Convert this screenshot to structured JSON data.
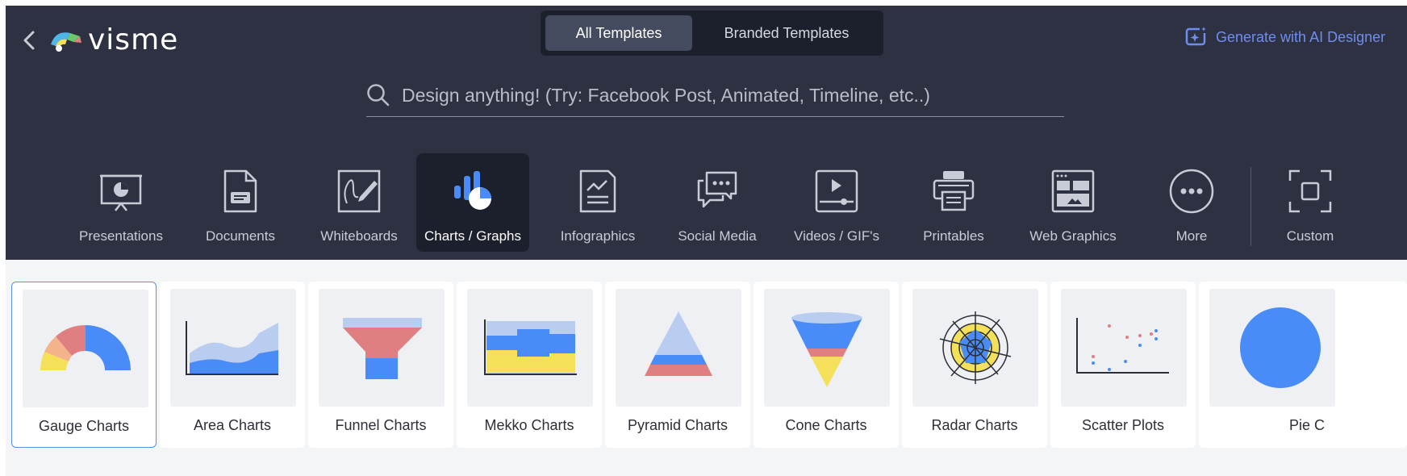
{
  "brand": {
    "name": "visme"
  },
  "tabs": [
    {
      "label": "All Templates"
    },
    {
      "label": "Branded Templates"
    }
  ],
  "ai_button": {
    "label": "Generate with AI Designer"
  },
  "search": {
    "placeholder": "Design anything! (Try: Facebook Post, Animated, Timeline, etc..)"
  },
  "categories": [
    {
      "label": "Presentations",
      "icon": "presentation-icon"
    },
    {
      "label": "Documents",
      "icon": "document-icon"
    },
    {
      "label": "Whiteboards",
      "icon": "whiteboard-icon"
    },
    {
      "label": "Charts / Graphs",
      "icon": "chart-icon"
    },
    {
      "label": "Infographics",
      "icon": "infographic-icon"
    },
    {
      "label": "Social Media",
      "icon": "chat-bubbles-icon"
    },
    {
      "label": "Videos / GIF's",
      "icon": "video-icon"
    },
    {
      "label": "Printables",
      "icon": "printer-icon"
    },
    {
      "label": "Web Graphics",
      "icon": "web-graphics-icon"
    },
    {
      "label": "More",
      "icon": "more-icon"
    },
    {
      "label": "Custom",
      "icon": "custom-size-icon"
    }
  ],
  "templates": [
    {
      "label": "Gauge Charts"
    },
    {
      "label": "Area Charts"
    },
    {
      "label": "Funnel Charts"
    },
    {
      "label": "Mekko Charts"
    },
    {
      "label": "Pyramid Charts"
    },
    {
      "label": "Cone Charts"
    },
    {
      "label": "Radar Charts"
    },
    {
      "label": "Scatter Plots"
    },
    {
      "label": "Pie C"
    }
  ],
  "colors": {
    "header_bg": "#2d3142",
    "accent": "#6f8df0",
    "chart_blue": "#4a8cf7",
    "chart_red": "#e07f82",
    "chart_yellow": "#f5e05a",
    "chart_lightblue": "#b8cdf0"
  }
}
